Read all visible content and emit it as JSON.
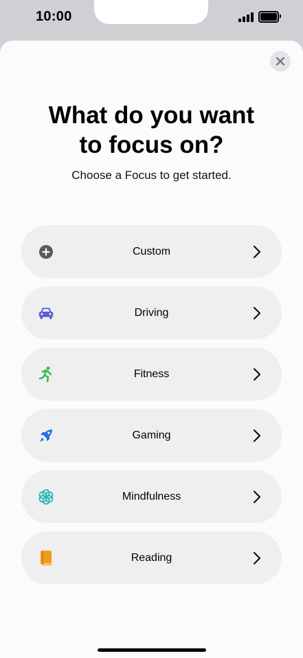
{
  "status_bar": {
    "time": "10:00"
  },
  "header": {
    "title_line1": "What do you want",
    "title_line2": "to focus on?",
    "subtitle": "Choose a Focus to get started."
  },
  "focus_options": [
    {
      "label": "Custom",
      "icon": "plus-circle-icon",
      "color": "#5a5a5e"
    },
    {
      "label": "Driving",
      "icon": "car-icon",
      "color": "#5b5bd6"
    },
    {
      "label": "Fitness",
      "icon": "running-figure-icon",
      "color": "#2fbf52"
    },
    {
      "label": "Gaming",
      "icon": "rocket-icon",
      "color": "#1f6fe8"
    },
    {
      "label": "Mindfulness",
      "icon": "flower-icon",
      "color": "#2bb7b4"
    },
    {
      "label": "Reading",
      "icon": "book-icon",
      "color": "#f29a1a"
    }
  ]
}
